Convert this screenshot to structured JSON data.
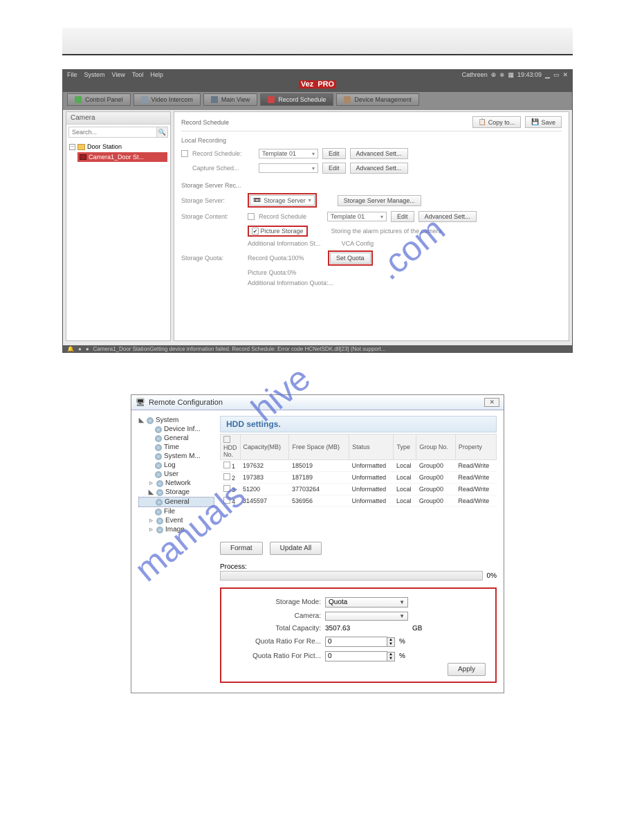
{
  "watermark": "manualshive.com",
  "app1": {
    "menu": [
      "File",
      "System",
      "View",
      "Tool",
      "Help"
    ],
    "logo_left": "Vez",
    "logo_right": "PRO",
    "user": "Cathreen",
    "time": "19:43:09",
    "tabs": [
      {
        "label": "Control Panel"
      },
      {
        "label": "Video Intercom"
      },
      {
        "label": "Main View"
      },
      {
        "label": "Record Schedule"
      },
      {
        "label": "Device Management"
      }
    ],
    "sidebar": {
      "title": "Camera",
      "search_ph": "Search...",
      "root": "Door Station",
      "selected": "Camera1_Door St..."
    },
    "main": {
      "title": "Record Schedule",
      "copy_btn": "Copy to...",
      "save_btn": "Save",
      "local": {
        "title": "Local Recording",
        "rec_label": "Record Schedule:",
        "cap_label": "Capture Sched...",
        "template": "Template 01",
        "edit": "Edit",
        "adv": "Advanced Sett..."
      },
      "srv": {
        "title": "Storage Server Rec...",
        "server_label": "Storage Server:",
        "server_val": "Storage Server",
        "manage": "Storage Server Manage...",
        "content_label": "Storage Content:",
        "rec_chk": "Record Schedule",
        "template": "Template 01",
        "edit": "Edit",
        "adv": "Advanced Sett...",
        "pic_chk": "Picture Storage",
        "pic_note": "Storing the alarm pictures of the camera",
        "add_info": "Additional Information St...",
        "vca": "VCA Config",
        "quota_label": "Storage Quota:",
        "rq": "Record Quota:100%",
        "pq": "Picture Quota:0%",
        "aq": "Additional Information Quota:...",
        "set_quota": "Set Quota"
      }
    },
    "status": "Camera1_Door StationGetting device information failed. Record Schedule: Error code HCNetSDK.dll[23] (Not support..."
  },
  "app2": {
    "title": "Remote Configuration",
    "tree": {
      "system": "System",
      "device": "Device Inf...",
      "general": "General",
      "time": "Time",
      "sysm": "System M...",
      "log": "Log",
      "user": "User",
      "network": "Network",
      "storage": "Storage",
      "storage_general": "General",
      "file": "File",
      "event": "Event",
      "image": "Image"
    },
    "panel_title": "HDD settings.",
    "cols": [
      "HDD No.",
      "Capacity(MB)",
      "Free Space (MB)",
      "Status",
      "Type",
      "Group No.",
      "Property"
    ],
    "rows": [
      {
        "no": "1",
        "cap": "197632",
        "free": "185019",
        "status": "Unformatted",
        "type": "Local",
        "group": "Group00",
        "prop": "Read/Write"
      },
      {
        "no": "2",
        "cap": "197383",
        "free": "187189",
        "status": "Unformatted",
        "type": "Local",
        "group": "Group00",
        "prop": "Read/Write"
      },
      {
        "no": "3",
        "cap": "51200",
        "free": "37703264",
        "status": "Unformatted",
        "type": "Local",
        "group": "Group00",
        "prop": "Read/Write"
      },
      {
        "no": "4",
        "cap": "3145597",
        "free": "536956",
        "status": "Unformatted",
        "type": "Local",
        "group": "Group00",
        "prop": "Read/Write"
      }
    ],
    "format_btn": "Format",
    "update_btn": "Update All",
    "process_label": "Process:",
    "process_pct": "0%",
    "form": {
      "mode_label": "Storage Mode:",
      "mode_val": "Quota",
      "camera_label": "Camera:",
      "camera_val": "",
      "cap_label": "Total Capacity:",
      "cap_val": "3507.63",
      "cap_unit": "GB",
      "qr_rec_label": "Quota Ratio For Re...",
      "qr_rec_val": "0",
      "pct": "%",
      "qr_pic_label": "Quota Ratio For Pict...",
      "qr_pic_val": "0",
      "apply": "Apply"
    }
  }
}
